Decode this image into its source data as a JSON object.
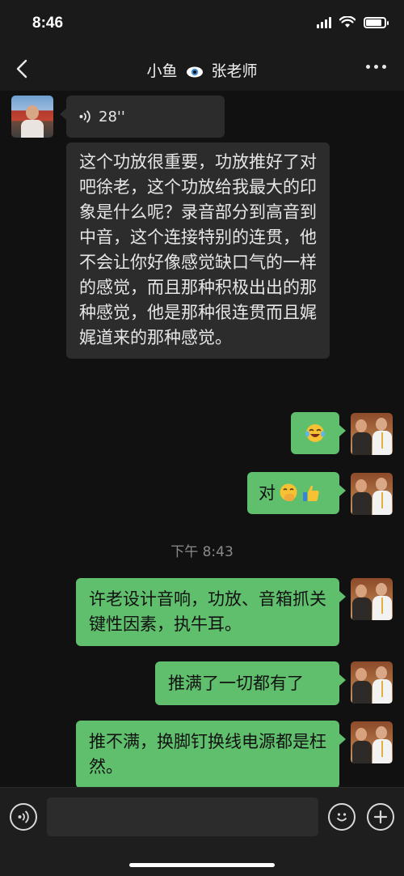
{
  "status_bar": {
    "time": "8:46"
  },
  "nav": {
    "title_left": "小鱼",
    "title_right": "张老师"
  },
  "messages": {
    "voice_duration": "28''",
    "incoming_text": "这个功放很重要，功放推好了对吧徐老，这个功放给我最大的印象是什么呢？录音部分到高音到中音，这个连接特别的连贯，他不会让你好像感觉缺口气的一样的感觉，而且那种积极出出的那种感觉，他是那种很连贯而且娓娓道来的那种感觉。",
    "out_yes": "对",
    "timestamp": "下午 8:43",
    "out_1": "许老设计音响，功放、音箱抓关键性因素，执牛耳。",
    "out_2": "推满了一切都有了",
    "out_3": "推不满，换脚钉换线电源都是枉然。"
  },
  "icons": {
    "back": "chevron-left-icon",
    "more": "more-dots-icon",
    "eye": "eye-emoji-icon",
    "voice": "voice-wave-icon",
    "emoji": "smiley-icon",
    "add": "plus-icon",
    "laugh": "laughing-tears-emoji",
    "shy": "hand-over-mouth-emoji",
    "thumb": "thumbs-up-emoji"
  },
  "colors": {
    "background": "#111111",
    "outgoing_bubble": "#5fbf6c",
    "incoming_bubble": "#2c2c2c"
  },
  "battery_level": 0.85
}
